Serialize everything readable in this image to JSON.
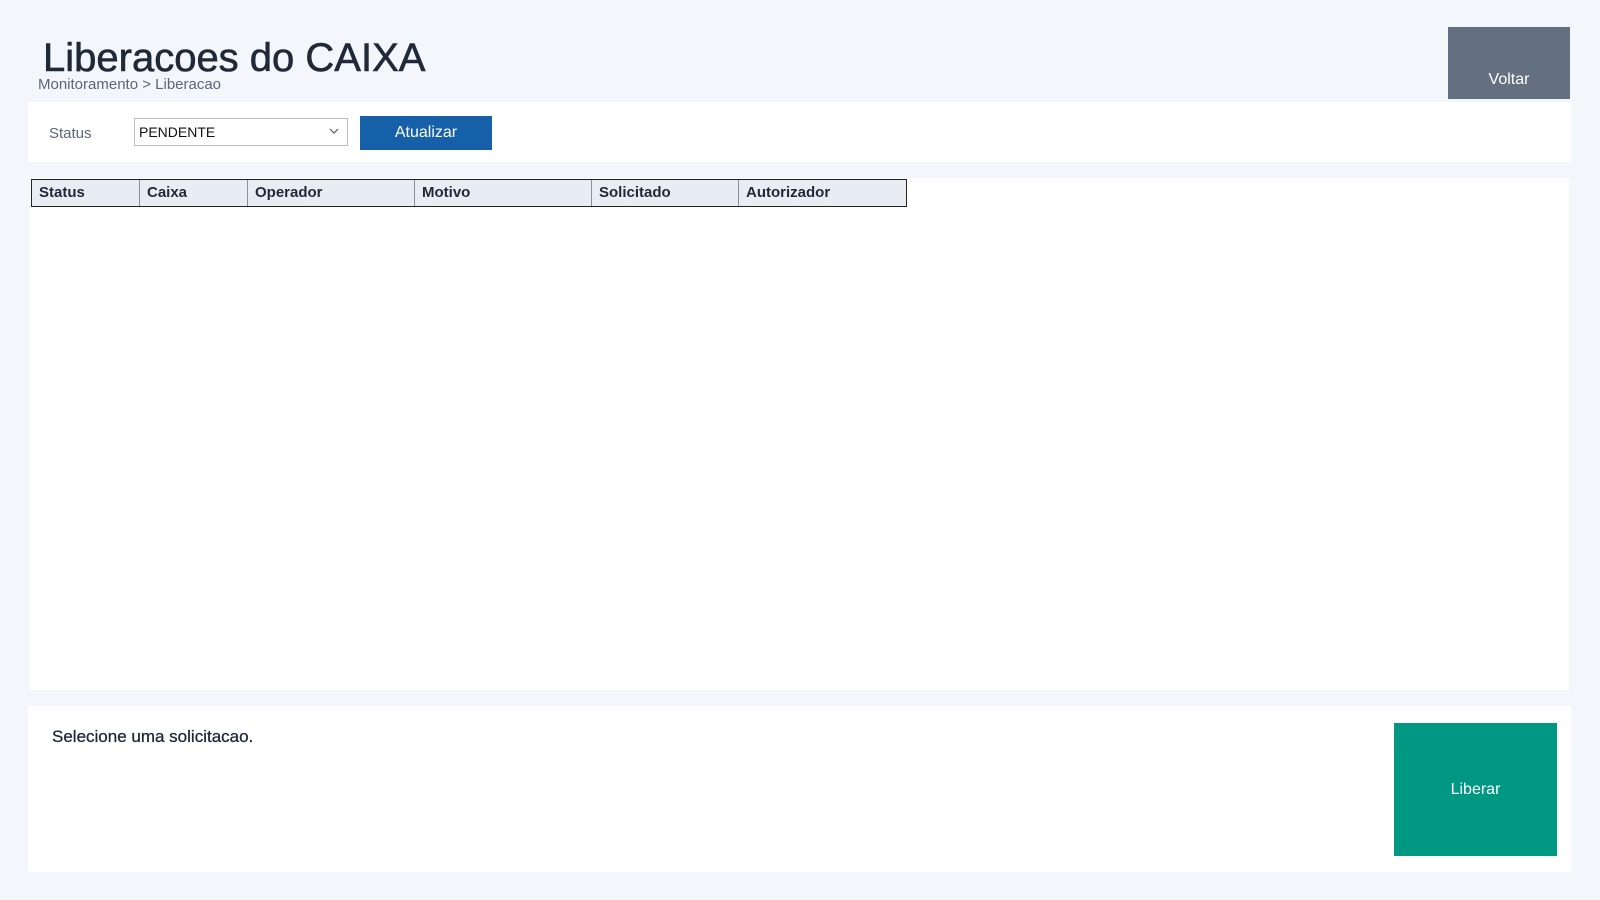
{
  "header": {
    "title": "Liberacoes do CAIXA",
    "breadcrumb": "Monitoramento > Liberacao",
    "back_label": "Voltar"
  },
  "filter": {
    "status_label": "Status",
    "status_value": "PENDENTE",
    "refresh_label": "Atualizar"
  },
  "table": {
    "columns": [
      "Status",
      "Caixa",
      "Operador",
      "Motivo",
      "Solicitado",
      "Autorizador"
    ],
    "rows": []
  },
  "detail": {
    "message": "Selecione uma solicitacao.",
    "release_label": "Liberar"
  },
  "colors": {
    "page_background": "#f3f6fa",
    "back_button": "#646f80",
    "refresh_button": "#1560a8",
    "release_button": "#009882",
    "table_header": "#e8edf4"
  },
  "icons": {
    "status_dropdown": "chevron-down-icon"
  }
}
